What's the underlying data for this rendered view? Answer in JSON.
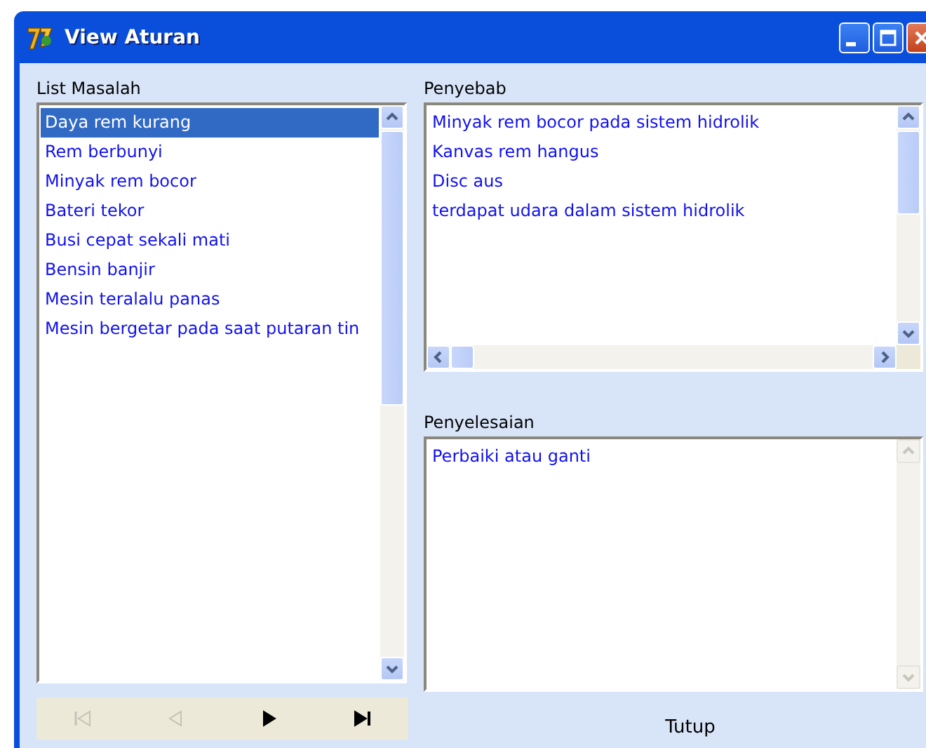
{
  "window": {
    "title": "View Aturan"
  },
  "list_masalah": {
    "label": "List Masalah",
    "items": [
      {
        "text": "Daya rem kurang",
        "selected": true
      },
      {
        "text": "Rem berbunyi",
        "selected": false
      },
      {
        "text": "Minyak rem bocor",
        "selected": false
      },
      {
        "text": "Bateri tekor",
        "selected": false
      },
      {
        "text": "Busi cepat sekali mati",
        "selected": false
      },
      {
        "text": "Bensin banjir",
        "selected": false
      },
      {
        "text": "Mesin teralalu panas",
        "selected": false
      },
      {
        "text": "Mesin bergetar pada saat putaran tin",
        "selected": false
      }
    ]
  },
  "penyebab": {
    "label": "Penyebab",
    "items": [
      "Minyak rem bocor pada sistem hidrolik",
      "Kanvas rem hangus",
      "Disc aus",
      "terdapat udara dalam sistem hidrolik"
    ]
  },
  "penyelesaian": {
    "label": "Penyelesaian",
    "text": "Perbaiki atau ganti"
  },
  "navigator": [
    {
      "kind": "first",
      "disabled": true
    },
    {
      "kind": "prev",
      "disabled": true
    },
    {
      "kind": "next",
      "disabled": false
    },
    {
      "kind": "last",
      "disabled": false
    }
  ],
  "close_button": {
    "label": "Tutup"
  }
}
